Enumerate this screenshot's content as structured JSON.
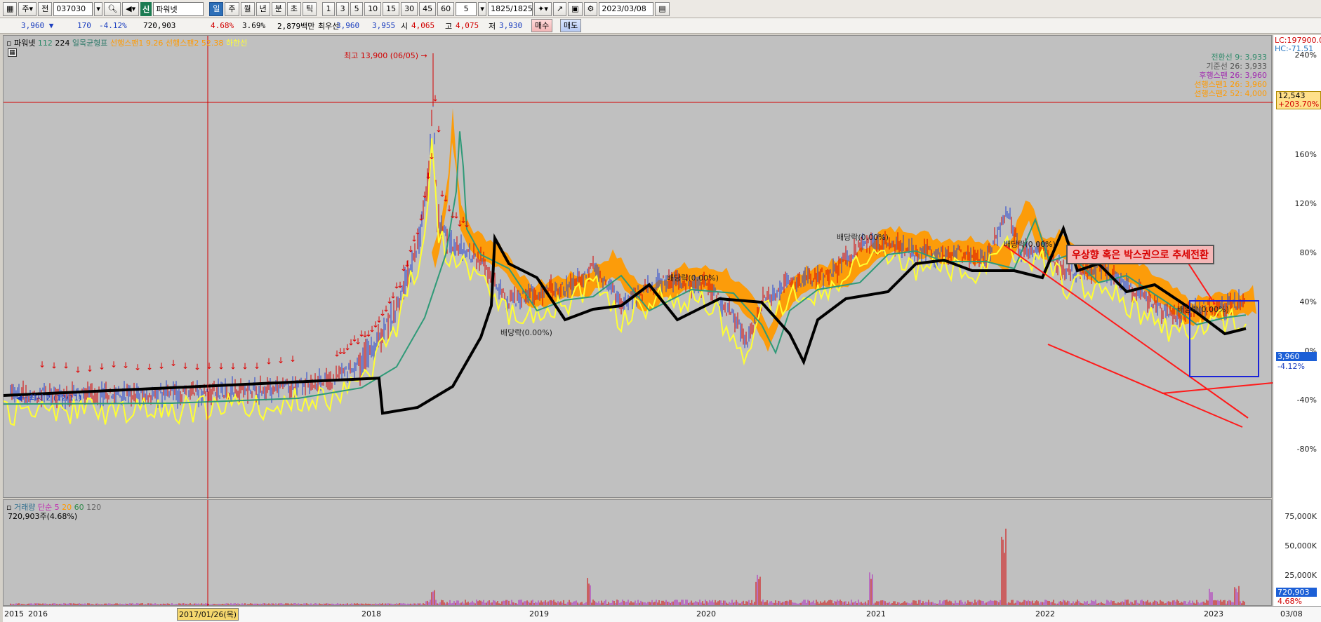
{
  "toolbar": {
    "period_mode": "주",
    "jeon": "전",
    "code": "037030",
    "name_tag": "신",
    "stock_name": "파워넷",
    "periods": [
      "일",
      "주",
      "월",
      "년",
      "분",
      "초",
      "틱"
    ],
    "intervals": [
      "1",
      "3",
      "5",
      "10",
      "15",
      "30",
      "45",
      "60"
    ],
    "interval_sel": "5",
    "count": "1825",
    "count_total": "/1825",
    "date": "2023/03/08"
  },
  "quote": {
    "price": "3,960",
    "arrow": "▼",
    "change": "170",
    "change_pct": "-4.12%",
    "volume": "720,903",
    "vol_pct": "4.68%",
    "turnover": "3.69%",
    "amount": "2,879백만",
    "best_label": "최우선",
    "ask": "3,960",
    "bid": "3,955",
    "open_label": "시",
    "open": "4,065",
    "high_label": "고",
    "high": "4,075",
    "low_label": "저",
    "low": "3,930",
    "buy": "매수",
    "sell": "매도"
  },
  "legend": {
    "name": "파워넷",
    "p1": "112",
    "p2": "224",
    "ichimoku": "일목균형표",
    "span1": "선행스팬1 9.26",
    "span2": "선행스팬2 52.38",
    "base": "하한선"
  },
  "markers": {
    "high": "최고 13,900 (06/05)",
    "low": "최저 2 (12/11)",
    "div": "배당락(0.00%)"
  },
  "right_info": {
    "lc": "LC:197900.0",
    "hc": "HC:-71.51",
    "tenkan": "전환선 9: 3,933",
    "kijun": "기준선 26: 3,933",
    "chikou": "후행스팬 26: 3,960",
    "span_a": "선행스팬1 26: 3,960",
    "span_b": "선행스팬2 52: 4,000",
    "crosshair_price": "12,543",
    "crosshair_pct": "+203.70%",
    "cur_price": "3,960",
    "cur_pct": "-4.12%"
  },
  "y_ticks": [
    "240%",
    "160%",
    "120%",
    "80%",
    "40%",
    "0%",
    "-40%",
    "-80%"
  ],
  "volume": {
    "legend_name": "거래량",
    "ma_label": "단순",
    "ma1": "5",
    "ma2": "20",
    "ma3": "60",
    "ma4": "120",
    "current": "720,903주(4.68%)",
    "ticks": [
      "75,000K",
      "50,000K",
      "25,000K"
    ],
    "cur_tag": "720,903",
    "cur_pct": "4.68%"
  },
  "x_ticks": [
    "2015",
    "2016",
    "2017/01/26(목)",
    "2018",
    "2019",
    "2020",
    "2021",
    "2022",
    "2023",
    "03/08"
  ],
  "annotation": "우상향 혹은 박스권으로 추세전환",
  "colors": {
    "candle_up": "#d40000",
    "candle_down": "#1f3fd0",
    "cloud": "#ff9a00",
    "ma_black": "#000000",
    "ma_green": "#2f9a78",
    "ma_yellow": "#ffff33"
  },
  "icons": [
    "chart-icon",
    "dropdown-icon",
    "search-icon",
    "speaker-icon",
    "settings-icon",
    "save-icon",
    "calendar-icon"
  ]
}
